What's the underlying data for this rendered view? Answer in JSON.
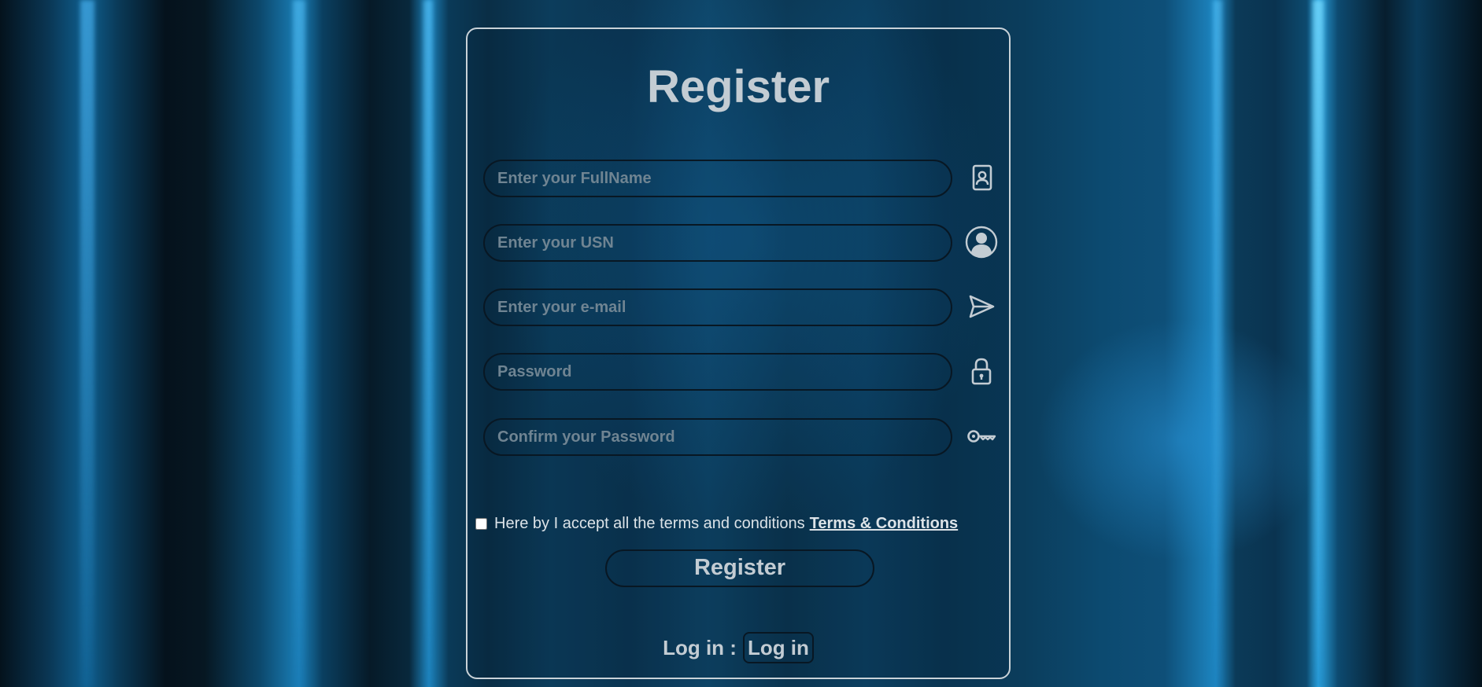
{
  "form": {
    "title": "Register",
    "fields": [
      {
        "placeholder": "Enter your FullName",
        "icon": "contact-card-icon"
      },
      {
        "placeholder": "Enter your USN",
        "icon": "user-avatar-icon"
      },
      {
        "placeholder": "Enter your e-mail",
        "icon": "send-icon"
      },
      {
        "placeholder": "Password",
        "icon": "lock-icon"
      },
      {
        "placeholder": "Confirm your Password",
        "icon": "key-icon"
      }
    ],
    "terms_text": "Here by I accept all the terms and conditions",
    "terms_link": "Terms & Conditions",
    "terms_checked": false,
    "register_label": "Register",
    "login_prompt": "Log in :",
    "login_label": "Log in"
  },
  "colors": {
    "text": "#c3ccd3",
    "placeholder": "#6f8492",
    "card_border": "#c9d2d8",
    "field_border": "#081723"
  }
}
